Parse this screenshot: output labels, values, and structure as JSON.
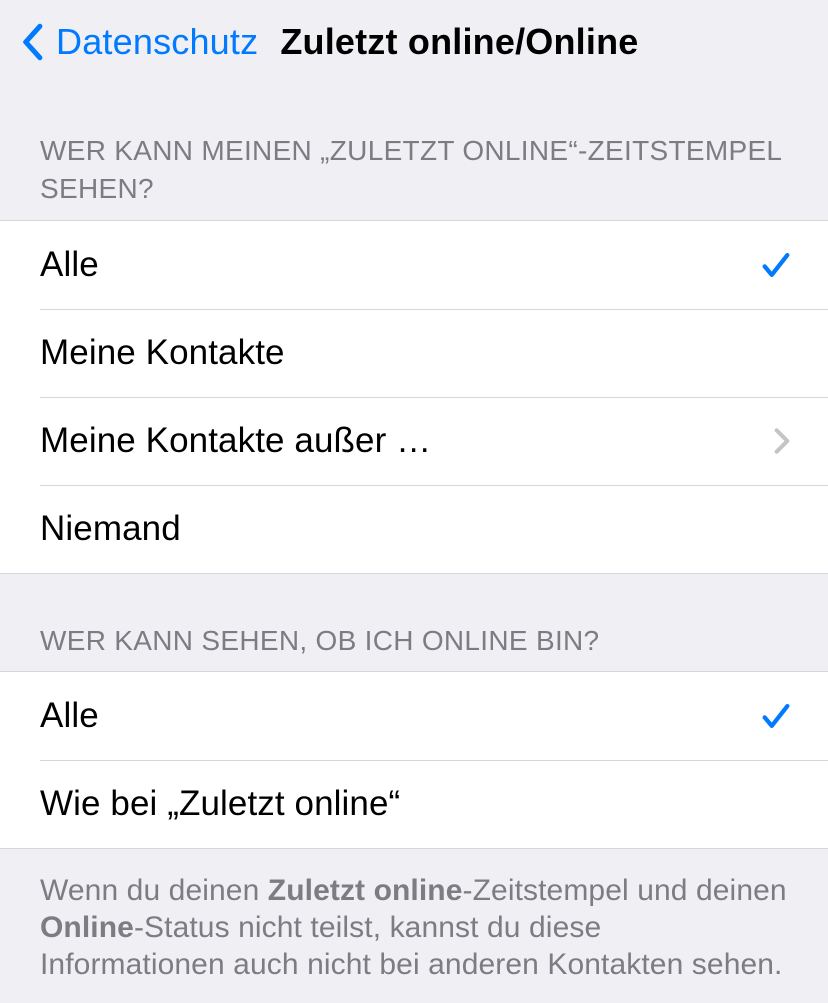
{
  "header": {
    "back_label": "Datenschutz",
    "title": "Zuletzt online/Online"
  },
  "section1": {
    "header": "WER KANN MEINEN „ZULETZT ONLINE“-ZEITSTEMPEL SEHEN?",
    "options": [
      {
        "label": "Alle",
        "selected": true,
        "disclosure": false
      },
      {
        "label": "Meine Kontakte",
        "selected": false,
        "disclosure": false
      },
      {
        "label": "Meine Kontakte außer …",
        "selected": false,
        "disclosure": true
      },
      {
        "label": "Niemand",
        "selected": false,
        "disclosure": false
      }
    ]
  },
  "section2": {
    "header": "WER KANN SEHEN, OB ICH ONLINE BIN?",
    "options": [
      {
        "label": "Alle",
        "selected": true,
        "disclosure": false
      },
      {
        "label": "Wie bei „Zuletzt online“",
        "selected": false,
        "disclosure": false
      }
    ]
  },
  "footer": {
    "prefix": "Wenn du deinen ",
    "bold1": "Zuletzt online",
    "mid1": "-Zeitstempel und deinen ",
    "bold2": "Online",
    "suffix": "-Status nicht teilst, kannst du diese Informationen auch nicht bei anderen Kontakten sehen."
  }
}
